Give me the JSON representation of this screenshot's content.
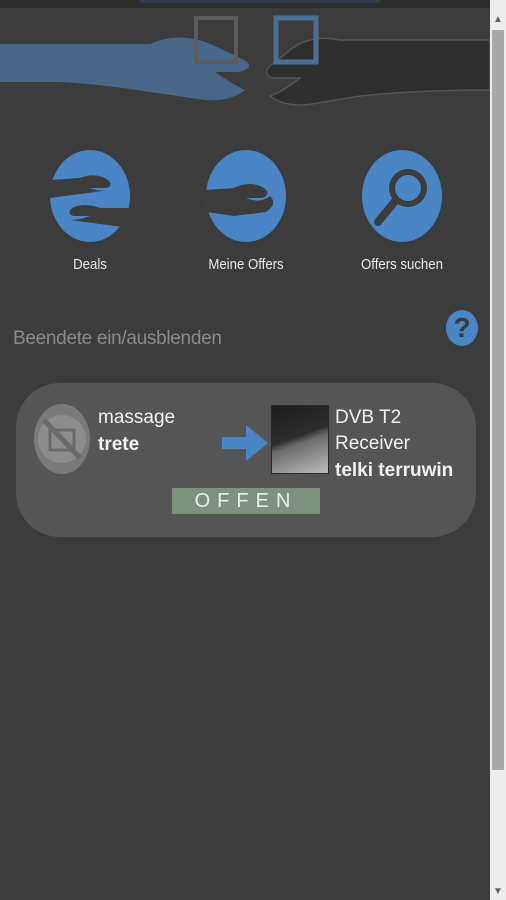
{
  "header": {
    "banner_icon": "hands-exchange-icon"
  },
  "nav": {
    "items": [
      {
        "label": "Deals",
        "icon": "hands-deal-icon"
      },
      {
        "label": "Meine Offers",
        "icon": "hand-offer-icon"
      },
      {
        "label": "Offers suchen",
        "icon": "magnifier-icon"
      }
    ]
  },
  "toggle_finished": "Beendete ein/ausblenden",
  "help": {
    "icon": "help-icon",
    "glyph": "?"
  },
  "deal": {
    "offer_title": "massage",
    "offer_user": "trete",
    "target_title_line1": "DVB T2",
    "target_title_line2": "Receiver",
    "target_user": "telki terruwin",
    "status": "OFFEN"
  },
  "scrollbar": {
    "up_glyph": "▲",
    "down_glyph": "▼"
  },
  "colors": {
    "accent": "#4a86c5",
    "background": "#3c3c3c",
    "card": "#555555",
    "status_badge": "#7d927d"
  }
}
